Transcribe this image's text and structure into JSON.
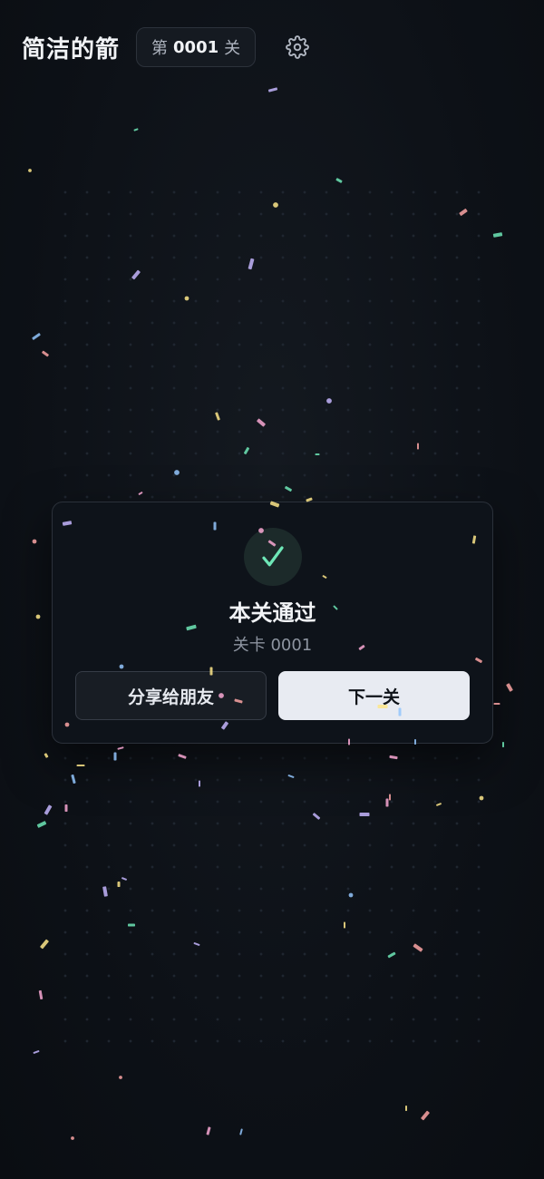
{
  "header": {
    "title": "简洁的箭",
    "level_prefix": "第",
    "level_number": "0001",
    "level_suffix": "关",
    "settings_icon": "gear-icon"
  },
  "dialog": {
    "icon": "check-icon",
    "title": "本关通过",
    "subtitle": "关卡 0001",
    "share_label": "分享给朋友",
    "next_label": "下一关"
  },
  "colors": {
    "background": "#0d1117",
    "accent_green": "#6ee7b7",
    "confetti": [
      "#c4b5fd",
      "#6ee7b7",
      "#fca5a5",
      "#fde68a",
      "#93c5fd",
      "#f9a8d4"
    ]
  }
}
